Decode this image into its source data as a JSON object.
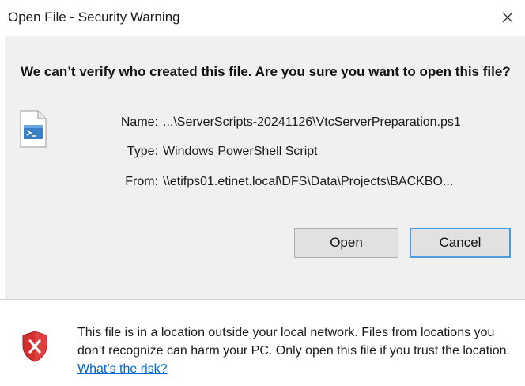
{
  "window": {
    "title": "Open File - Security Warning",
    "close_glyph": "✕"
  },
  "prompt": {
    "headline": "We can’t verify who created this file. Are you sure you want to open this file?"
  },
  "file": {
    "icon": "powershell-script-file-icon",
    "name_label": "Name:",
    "name_value": "...\\ServerScripts-20241126\\VtcServerPreparation.ps1",
    "type_label": "Type:",
    "type_value": "Windows PowerShell Script",
    "from_label": "From:",
    "from_value": "\\\\etifps01.etinet.local\\DFS\\Data\\Projects\\BACKBO..."
  },
  "buttons": {
    "open_label": "Open",
    "cancel_label": "Cancel"
  },
  "footer": {
    "icon": "shield-warning-icon",
    "warning_text": "This file is in a location outside your local network. Files from locations you don’t recognize can harm your PC. Only open this file if you trust the location.",
    "risk_link": "What’s the risk?"
  },
  "colors": {
    "content_bg": "#f0f0f0",
    "link": "#0066cc",
    "focus_border": "#4a9be0",
    "shield_red": "#d32f2f"
  }
}
